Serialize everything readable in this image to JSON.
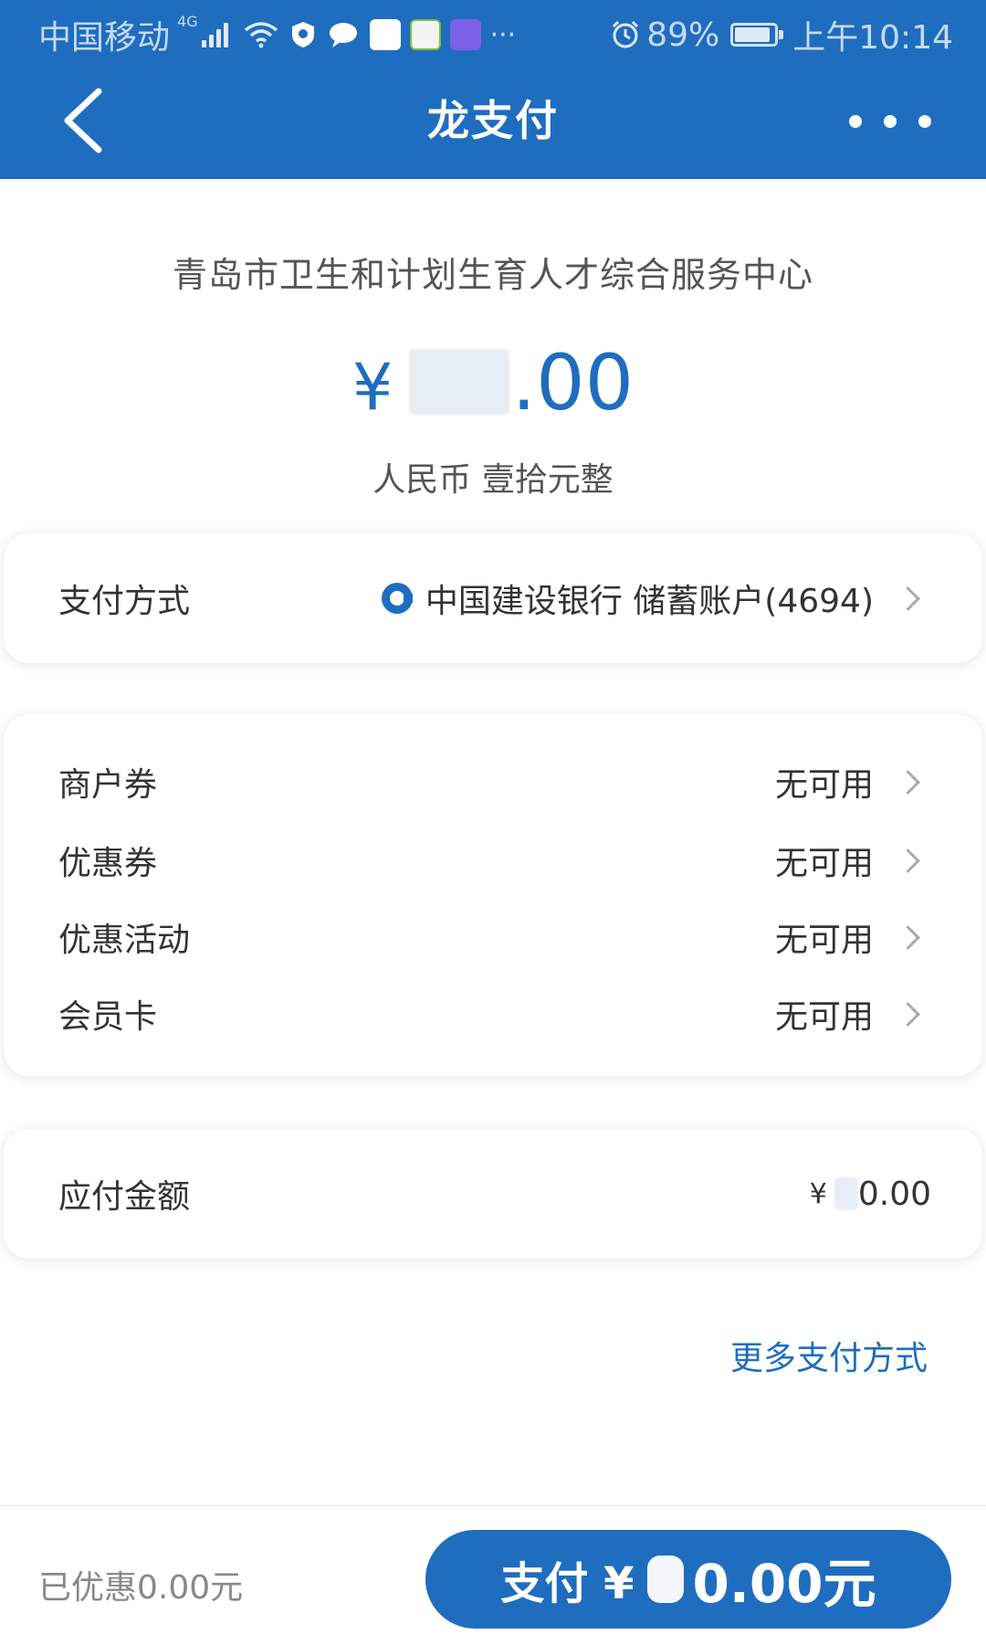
{
  "status_bar": {
    "carrier": "中国移动",
    "network": "4G",
    "battery": "89%",
    "time": "上午10:14",
    "more": "···",
    "battery_level": 0.89
  },
  "nav": {
    "title": "龙支付"
  },
  "merchant": {
    "name": "青岛市卫生和计划生育人才综合服务中心"
  },
  "amount": {
    "currency_symbol": "¥",
    "visible_fraction": ".00",
    "in_words": "人民币 壹拾元整"
  },
  "payment_method": {
    "label": "支付方式",
    "value": "中国建设银行 储蓄账户(4694)"
  },
  "discounts": [
    {
      "label": "商户券",
      "value": "无可用"
    },
    {
      "label": "优惠券",
      "value": "无可用"
    },
    {
      "label": "优惠活动",
      "value": "无可用"
    },
    {
      "label": "会员卡",
      "value": "无可用"
    }
  ],
  "payable": {
    "label": "应付金额",
    "currency_symbol": "¥",
    "visible_amount": "0.00"
  },
  "more_payment": {
    "label": "更多支付方式"
  },
  "bottom": {
    "saved": "已优惠0.00元",
    "pay_prefix": "支付 ¥",
    "pay_amount": "0.00元"
  },
  "colors": {
    "brand": "#1f6dbf"
  }
}
